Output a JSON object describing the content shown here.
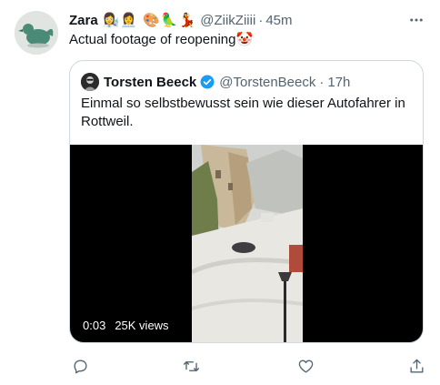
{
  "tweet": {
    "display_name": "Zara",
    "name_emojis": "👩‍🔬👩‍💼 🎨🦜💃",
    "handle": "@ZiikZiiii",
    "separator": "·",
    "time": "45m",
    "text": "Actual footage of reopening🤡"
  },
  "quoted_tweet": {
    "display_name": "Torsten Beeck",
    "handle": "@TorstenBeeck",
    "separator": "·",
    "time": "17h",
    "text": "Einmal so selbstbewusst sein wie dieser Autofahrer in Rottweil.",
    "video": {
      "duration": "0:03",
      "views": "25K views"
    }
  },
  "colors": {
    "text_primary": "#0f1419",
    "text_secondary": "#536471",
    "verified": "#1d9bf0",
    "border": "#cfd9de"
  },
  "icons": {
    "more": "more-icon",
    "verified": "verified-badge-icon",
    "reply": "reply-icon",
    "retweet": "retweet-icon",
    "like": "like-icon",
    "share": "share-icon"
  }
}
